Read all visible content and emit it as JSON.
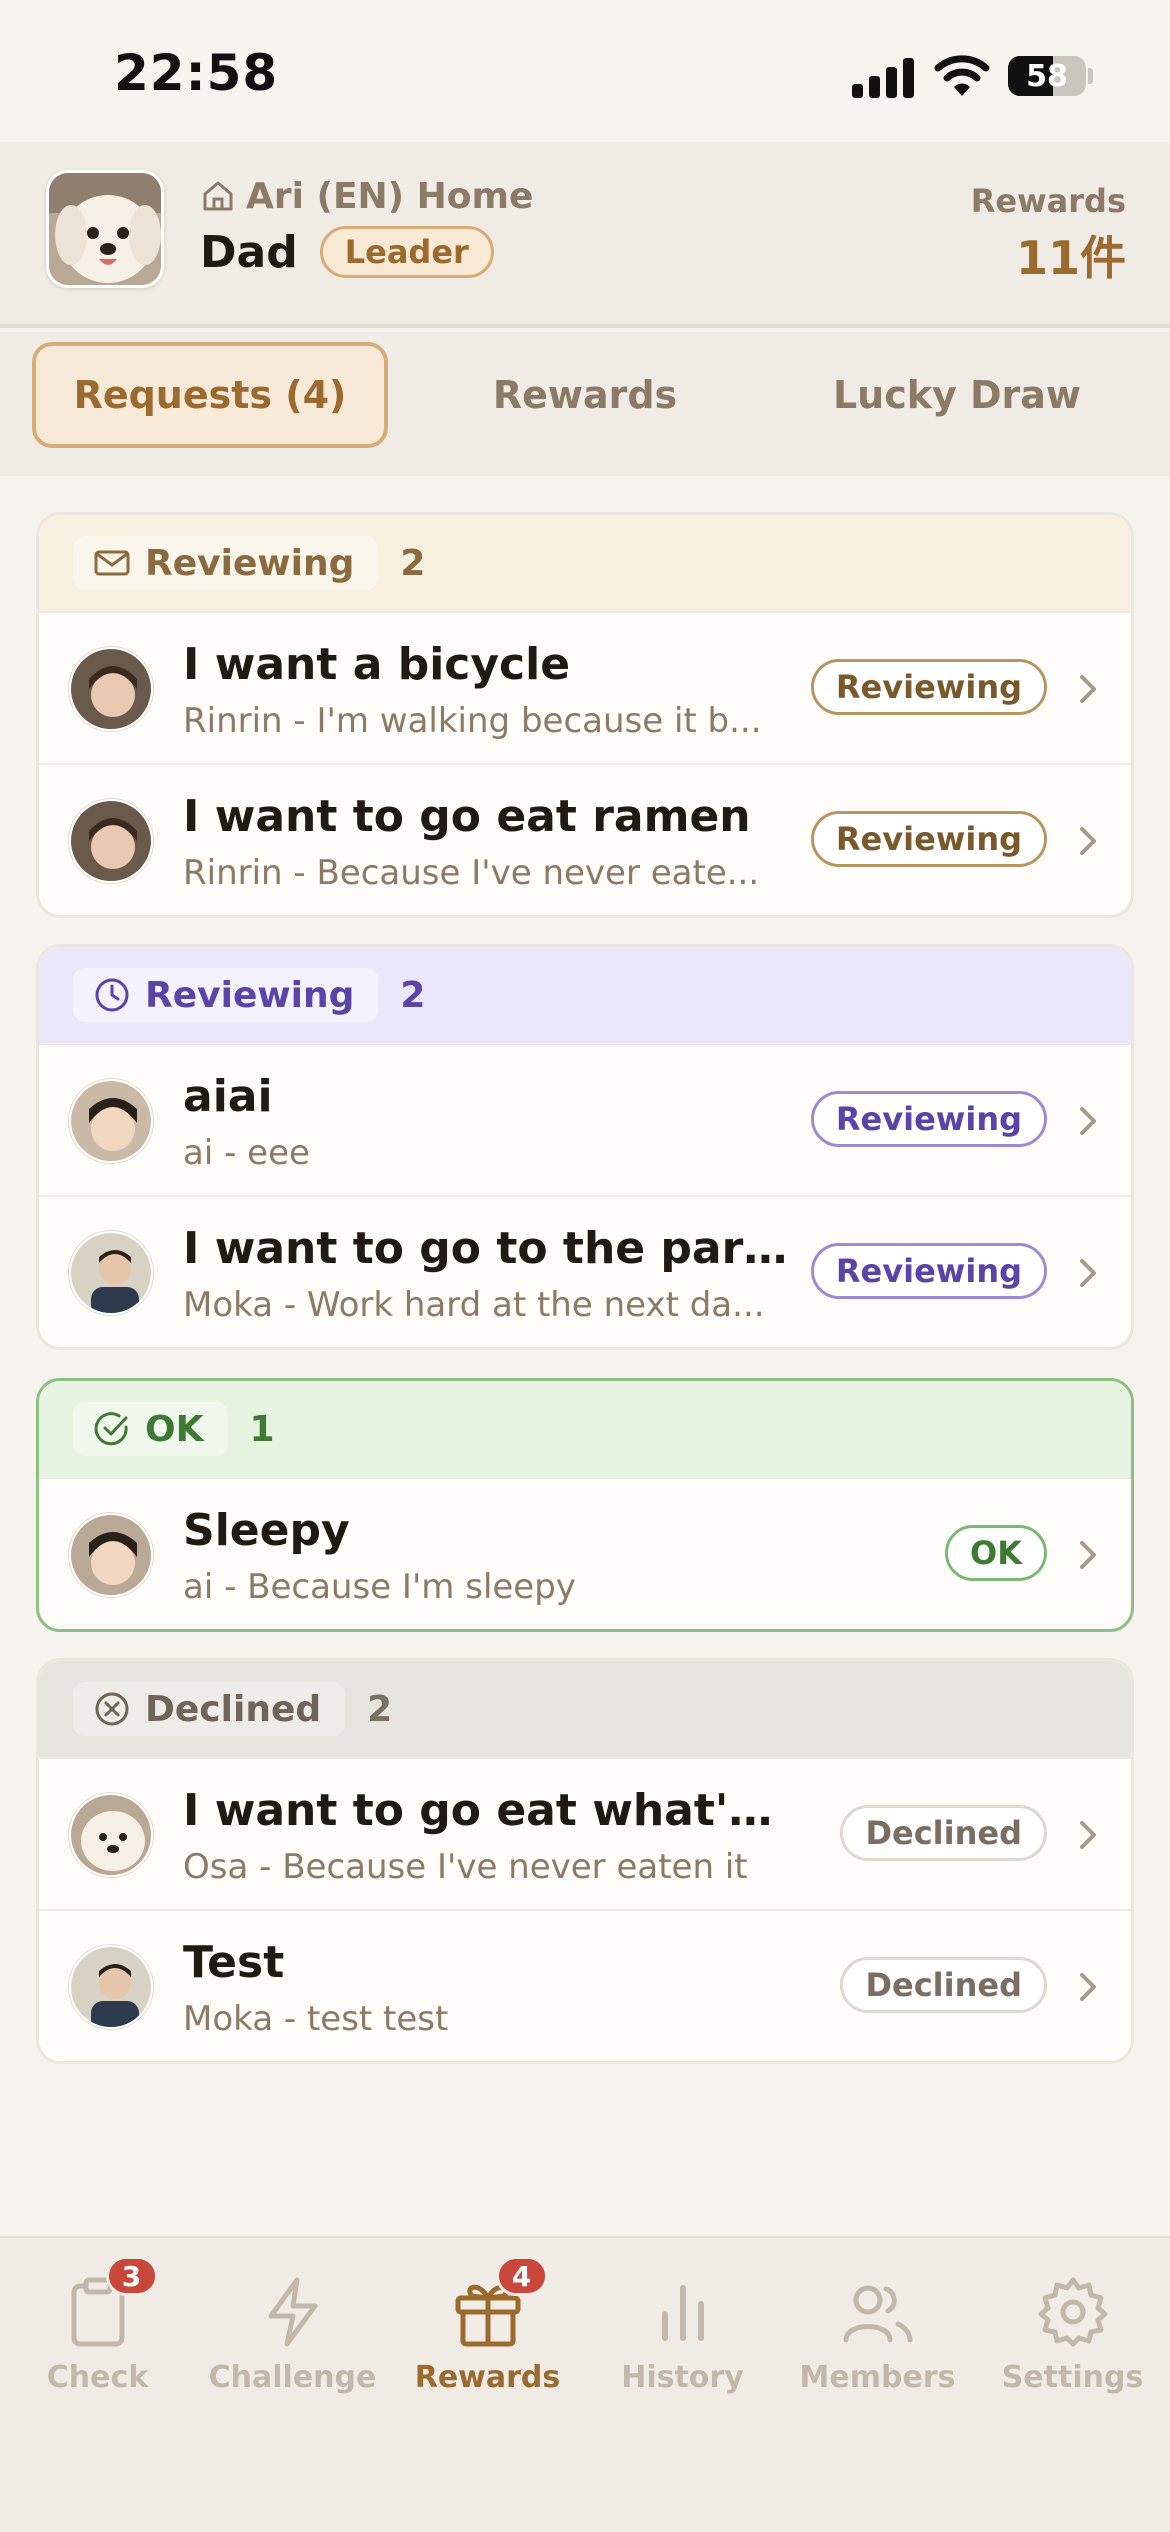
{
  "status_bar": {
    "time": "22:58",
    "battery": "58",
    "battery_level": 0.58
  },
  "header": {
    "home_name": "Ari (EN) Home",
    "user_name": "Dad",
    "role": "Leader",
    "rewards_label": "Rewards",
    "rewards_count": "11件"
  },
  "tabs": [
    {
      "label": "Requests (4)",
      "active": true
    },
    {
      "label": "Rewards",
      "active": false
    },
    {
      "label": "Lucky Draw",
      "active": false
    }
  ],
  "groups": [
    {
      "status": "Reviewing",
      "count": "2",
      "theme": "amber",
      "icon": "envelope-icon",
      "items": [
        {
          "title": "I want a bicycle",
          "subtitle": "Rinrin - I'm walking because it b...",
          "badge": "Reviewing",
          "avatar": "child-photo"
        },
        {
          "title": "I want to go eat ramen",
          "subtitle": "Rinrin - Because I've never eate...",
          "badge": "Reviewing",
          "avatar": "child-photo"
        }
      ]
    },
    {
      "status": "Reviewing",
      "count": "2",
      "theme": "purple",
      "icon": "clock-icon",
      "items": [
        {
          "title": "aiai",
          "subtitle": "ai - eee",
          "badge": "Reviewing",
          "avatar": "child-photo"
        },
        {
          "title": "I want to go to the park...",
          "subtitle": "Moka - Work hard at the next da...",
          "badge": "Reviewing",
          "avatar": "adult-photo"
        }
      ]
    },
    {
      "status": "OK",
      "count": "1",
      "theme": "green",
      "icon": "check-circle-icon",
      "items": [
        {
          "title": "Sleepy",
          "subtitle": "ai - Because I'm sleepy",
          "badge": "OK",
          "avatar": "child-photo"
        }
      ]
    },
    {
      "status": "Declined",
      "count": "2",
      "theme": "gray",
      "icon": "x-circle-icon",
      "items": [
        {
          "title": "I want to go eat what's c...",
          "subtitle": "Osa - Because I've never eaten it",
          "badge": "Declined",
          "avatar": "dog-photo"
        },
        {
          "title": "Test",
          "subtitle": "Moka - test test",
          "badge": "Declined",
          "avatar": "adult-photo"
        }
      ]
    }
  ],
  "bottom_nav": [
    {
      "label": "Check",
      "icon": "clipboard-icon",
      "badge": "3",
      "active": false
    },
    {
      "label": "Challenge",
      "icon": "lightning-icon",
      "badge": "",
      "active": false
    },
    {
      "label": "Rewards",
      "icon": "gift-icon",
      "badge": "4",
      "active": true
    },
    {
      "label": "History",
      "icon": "bar-chart-icon",
      "badge": "",
      "active": false
    },
    {
      "label": "Members",
      "icon": "users-icon",
      "badge": "",
      "active": false
    },
    {
      "label": "Settings",
      "icon": "gear-icon",
      "badge": "",
      "active": false
    }
  ],
  "colors": {
    "accent": "#9a6a2e",
    "amber": "#8a6a3e",
    "purple": "#5a44a8",
    "green": "#3e7a34",
    "gray": "#7a6e62",
    "notification": "#c9473a"
  }
}
